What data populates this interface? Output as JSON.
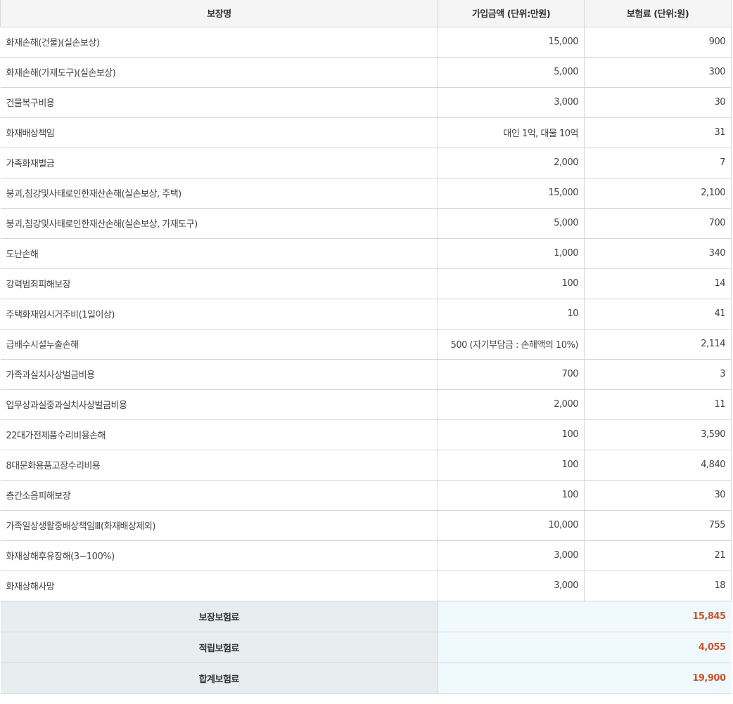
{
  "header": {
    "col_name": "보장명",
    "col_amount": "가입금액 (단위:만원)",
    "col_premium": "보험료 (단위:원)"
  },
  "rows": [
    {
      "name": "화재손해(건물)(실손보상)",
      "amount": "15,000",
      "premium": "900"
    },
    {
      "name": "화재손해(가재도구)(실손보상)",
      "amount": "5,000",
      "premium": "300"
    },
    {
      "name": "건물복구비용",
      "amount": "3,000",
      "premium": "30"
    },
    {
      "name": "화재배상책임",
      "amount": "대인 1억, 대물 10억",
      "premium": "31"
    },
    {
      "name": "가족화재벌금",
      "amount": "2,000",
      "premium": "7"
    },
    {
      "name": "붕괴,침강및사태로인한재산손해(실손보상, 주택)",
      "amount": "15,000",
      "premium": "2,100"
    },
    {
      "name": "붕괴,침강및사태로인한재산손해(실손보상, 가재도구)",
      "amount": "5,000",
      "premium": "700"
    },
    {
      "name": "도난손해",
      "amount": "1,000",
      "premium": "340"
    },
    {
      "name": "강력범죄피해보장",
      "amount": "100",
      "premium": "14"
    },
    {
      "name": "주택화재임시거주비(1일이상)",
      "amount": "10",
      "premium": "41"
    },
    {
      "name": "급배수시설누출손해",
      "amount": "500 (자기부담금 : 손해액의 10%)",
      "premium": "2,114"
    },
    {
      "name": "가족과실치사상벌금비용",
      "amount": "700",
      "premium": "3"
    },
    {
      "name": "업무상과실중과실치사상벌금비용",
      "amount": "2,000",
      "premium": "11"
    },
    {
      "name": "22대가전제품수리비용손해",
      "amount": "100",
      "premium": "3,590"
    },
    {
      "name": "8대문화용품고장수리비용",
      "amount": "100",
      "premium": "4,840"
    },
    {
      "name": "층간소음피해보장",
      "amount": "100",
      "premium": "30"
    },
    {
      "name": "가족일상생활중배상책임Ⅲ(화재배상제외)",
      "amount": "10,000",
      "premium": "755"
    },
    {
      "name": "화재상해후유장해(3~100%)",
      "amount": "3,000",
      "premium": "21"
    },
    {
      "name": "화재상해사망",
      "amount": "3,000",
      "premium": "18"
    }
  ],
  "summary": [
    {
      "label": "보장보험료",
      "value": "15,845"
    },
    {
      "label": "적립보험료",
      "value": "4,055"
    },
    {
      "label": "합계보험료",
      "value": "19,900"
    }
  ],
  "colors": {
    "accent": "#c8562a",
    "header_bg": "#f5f5f5",
    "summary_label_bg": "#e8eef0",
    "summary_value_bg": "#f0f9fd",
    "border": "#d6d6d6"
  }
}
